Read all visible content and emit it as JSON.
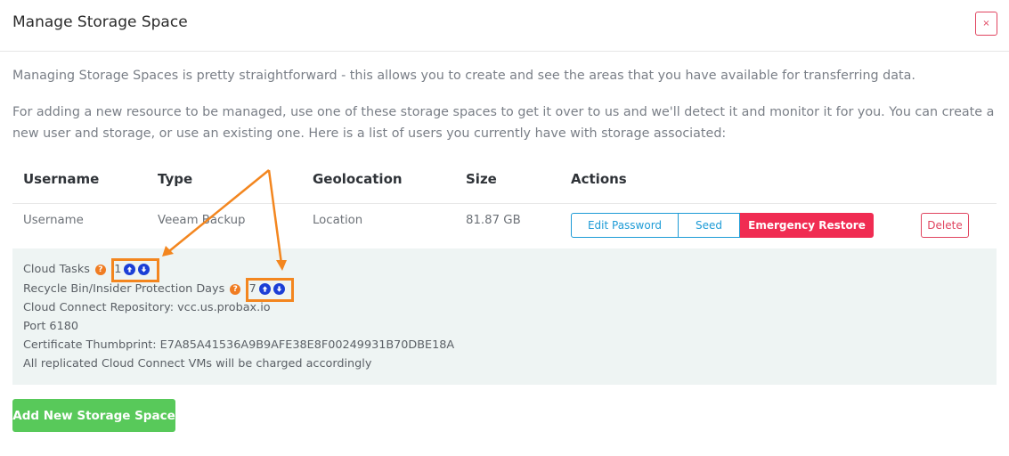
{
  "header": {
    "title": "Manage Storage Space",
    "close_label": "×"
  },
  "intro": {
    "p1": "Managing Storage Spaces is pretty straightforward - this allows you to create and see the areas that you have available for transferring data.",
    "p2": "For adding a new resource to be managed, use one of these storage spaces to get it over to us and we'll detect it and monitor it for you. You can create a new user and storage, or use an existing one. Here is a list of users you currently have with storage associated:"
  },
  "table": {
    "headers": {
      "username": "Username",
      "type": "Type",
      "geolocation": "Geolocation",
      "size": "Size",
      "actions": "Actions"
    },
    "row": {
      "username": "Username",
      "type": "Veeam Backup",
      "geolocation": "Location",
      "size": "81.87 GB",
      "edit_password": "Edit Password",
      "seed": "Seed",
      "emergency_restore": "Emergency Restore",
      "delete": "Delete"
    }
  },
  "details": {
    "cloud_tasks_label": "Cloud Tasks",
    "cloud_tasks_value": ":1",
    "recycle_label": "Recycle Bin/Insider Protection Days",
    "recycle_value": ":7",
    "help_glyph": "?",
    "repository": "Cloud Connect Repository: vcc.us.probax.io",
    "port": "Port 6180",
    "thumbprint": "Certificate Thumbprint: E7A85A41536A9B9AFE38E8F00249931B70DBE18A",
    "note": "All replicated Cloud Connect VMs will be charged accordingly"
  },
  "footer": {
    "add_label": "Add New Storage Space"
  },
  "colors": {
    "accent_blue": "#1d9bd6",
    "danger": "#f02c52",
    "success": "#58c95a",
    "annotation": "#f3861f",
    "details_bg": "#eef4f3"
  },
  "icons": [
    "close-icon",
    "help-icon",
    "arrow-up-icon",
    "arrow-down-icon"
  ]
}
